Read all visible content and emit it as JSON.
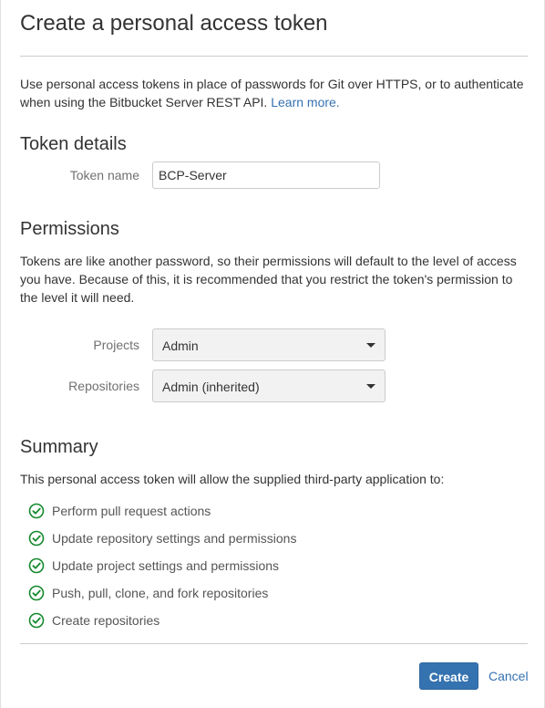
{
  "dialog": {
    "title": "Create a personal access token",
    "intro_text": "Use personal access tokens in place of passwords for Git over HTTPS, or to authenticate when using the Bitbucket Server REST API.",
    "learn_more": "Learn more."
  },
  "token_details": {
    "heading": "Token details",
    "name_label": "Token name",
    "name_value": "BCP-Server"
  },
  "permissions": {
    "heading": "Permissions",
    "description": "Tokens are like another password, so their permissions will default to the level of access you have. Because of this, it is recommended that you restrict the token's permission to the level it will need.",
    "projects_label": "Projects",
    "projects_value": "Admin",
    "repositories_label": "Repositories",
    "repositories_value": "Admin (inherited)"
  },
  "summary": {
    "heading": "Summary",
    "description": "This personal access token will allow the supplied third-party application to:",
    "items": [
      "Perform pull request actions",
      "Update repository settings and permissions",
      "Update project settings and permissions",
      "Push, pull, clone, and fork repositories",
      "Create repositories"
    ]
  },
  "footer": {
    "create_label": "Create",
    "cancel_label": "Cancel"
  },
  "colors": {
    "primary": "#3572b0",
    "check_green": "#14892c"
  },
  "icons": {
    "summary_item": "check-circle-icon",
    "select_caret": "caret-down-icon"
  }
}
